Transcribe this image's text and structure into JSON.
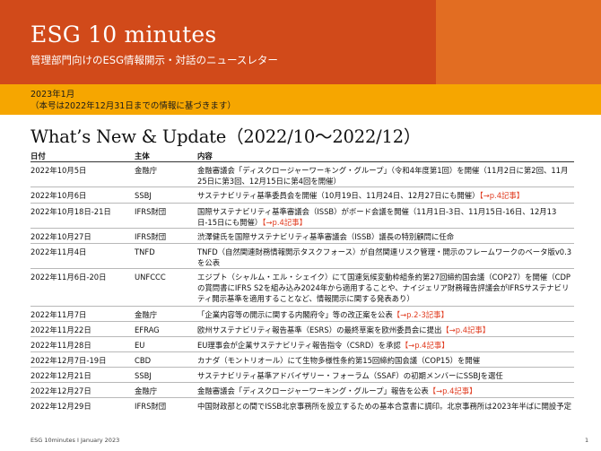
{
  "header": {
    "title": "ESG 10 minutes",
    "subtitle": "管理部門向けのESG情報開示・対話のニュースレター"
  },
  "issue": {
    "date": "2023年1月",
    "note": "（本号は2022年12月31日までの情報に基づきます）"
  },
  "section_title": "What’s New & Update（2022/10～2022/12）",
  "table": {
    "headers": {
      "date": "日付",
      "org": "主体",
      "content": "内容"
    },
    "rows": [
      {
        "date": "2022年10月5日",
        "org": "金融庁",
        "content": "金融審議会「ディスクロージャーワーキング・グループ」（令和4年度第1回）を開催（11月2日に第2回、11月25日に第3回、12月15日に第4回を開催）",
        "ref": ""
      },
      {
        "date": "2022年10月6日",
        "org": "SSBJ",
        "content": "サステナビリティ基準委員会を開催（10月19日、11月24日、12月27日にも開催）",
        "ref": "【→p.4記事】"
      },
      {
        "date": "2022年10月18日-21日",
        "org": "IFRS財団",
        "content": "国際サステナビリティ基準審議会（ISSB）がボード会議を開催（11月1日-3日、11月15日-16日、12月13日-15日にも開催）",
        "ref": "【→p.4記事】"
      },
      {
        "date": "2022年10月27日",
        "org": "IFRS財団",
        "content": "渋澤健氏を国際サステナビリティ基準審議会（ISSB）議長の特別顧問に任命",
        "ref": ""
      },
      {
        "date": "2022年11月4日",
        "org": "TNFD",
        "content": "TNFD（自然関連財務情報開示タスクフォース）が自然関連リスク管理・開示のフレームワークのベータ版v0.3を公表",
        "ref": ""
      },
      {
        "date": "2022年11月6日-20日",
        "org": "UNFCCC",
        "content": "エジプト（シャルム・エル・シェイク）にて国連気候変動枠組条約第27回締約国会議（COP27）を開催（CDPの賞問書にIFRS S2を組み込み2024年から適用することや、ナイジェリア財務報告評議会がIFRSサステナビリティ開示基準を適用することなど、情報開示に関する発表あり）",
        "ref": ""
      },
      {
        "date": "2022年11月7日",
        "org": "金融庁",
        "content": "「企業内容等の開示に関する内閣府令」等の改正案を公表",
        "ref": "【→p.2-3記事】"
      },
      {
        "date": "2022年11月22日",
        "org": "EFRAG",
        "content": "欧州サステナビリティ報告基準（ESRS）の最終草案を欧州委員会に提出",
        "ref": "【→p.4記事】"
      },
      {
        "date": "2022年11月28日",
        "org": "EU",
        "content": "EU理事会が企業サステナビリティ報告指令（CSRD）を承認",
        "ref": "【→p.4記事】"
      },
      {
        "date": "2022年12月7日-19日",
        "org": "CBD",
        "content": "カナダ（モントリオール）にて生物多様性条約第15回締約国会議（COP15）を開催",
        "ref": ""
      },
      {
        "date": "2022年12月21日",
        "org": "SSBJ",
        "content": "サステナビリティ基準アドバイザリー・フォーラム（SSAF）の初期メンバーにSSBJを選任",
        "ref": ""
      },
      {
        "date": "2022年12月27日",
        "org": "金融庁",
        "content": "金融審議会「ディスクロージャーワーキング・グループ」報告を公表",
        "ref": "【→p.4記事】"
      },
      {
        "date": "2022年12月29日",
        "org": "IFRS財団",
        "content": "中国財政部との間でISSB北京事務所を設立するための基本合意書に調印。北京事務所は2023年半ばに開設予定",
        "ref": ""
      }
    ]
  },
  "footer": {
    "left": "ESG 10minutes  I  January 2023",
    "page": "1"
  },
  "colors": {
    "header_red": "#d14a1a",
    "header_orange": "#e26d22",
    "band_yellow": "#f6a600",
    "ref_red": "#e03a1e"
  }
}
